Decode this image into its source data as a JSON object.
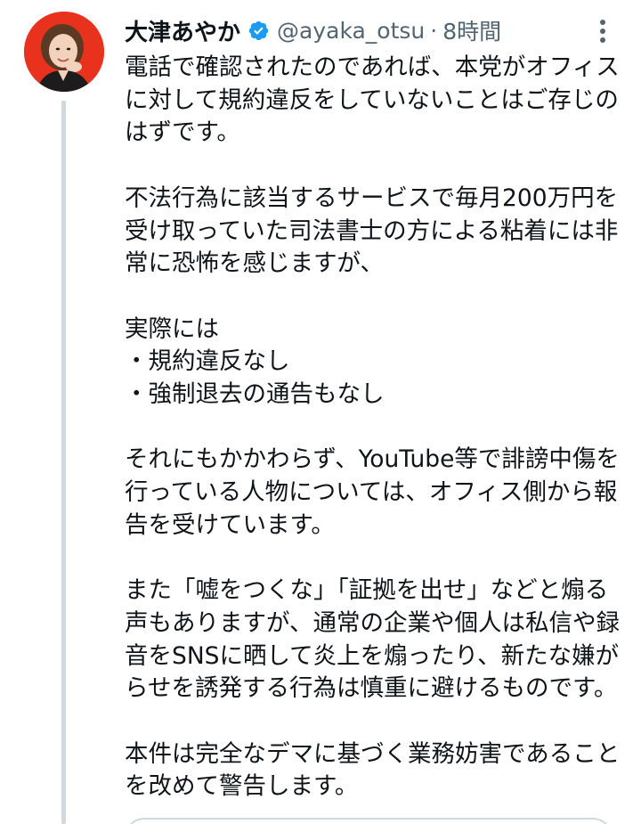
{
  "tweet": {
    "display_name": "大津あやか",
    "handle": "@ayaka_otsu",
    "separator": "·",
    "time": "8時間",
    "verified": true,
    "icons": {
      "verified": "verified-badge-icon",
      "more": "more-vertical-icon"
    },
    "paragraphs": [
      {
        "lines": [
          "電話で確認されたのであれば、本党がオフィス",
          "に対して規約違反をしていないことはご存じの",
          "はずです。"
        ]
      },
      {
        "lines": [
          "不法行為に該当するサービスで毎月200万円を",
          "受け取っていた司法書士の方による粘着には非",
          "常に恐怖を感じますが、"
        ]
      },
      {
        "lines": [
          "実際には",
          "・規約違反なし",
          "・強制退去の通告もなし"
        ]
      },
      {
        "lines": [
          "それにもかかわらず、YouTube等で誹謗中傷を",
          "行っている人物については、オフィス側から報",
          "告を受けています。"
        ]
      },
      {
        "lines": [
          "また「嘘をつくな」「証拠を出せ」などと煽る",
          "声もありますが、通常の企業や個人は私信や録",
          "音をSNSに晒して炎上を煽ったり、新たな嫌が",
          "らせを誘発する行為は慎重に避けるものです。"
        ]
      },
      {
        "lines": [
          "本件は完全なデマに基づく業務妨害であること",
          "を改めて警告します。"
        ]
      }
    ]
  },
  "colors": {
    "text": "#0f1419",
    "secondary": "#536471",
    "verified": "#1d9bf0",
    "avatar_bg": "#e8321e",
    "thread_line": "#cfd9de"
  }
}
